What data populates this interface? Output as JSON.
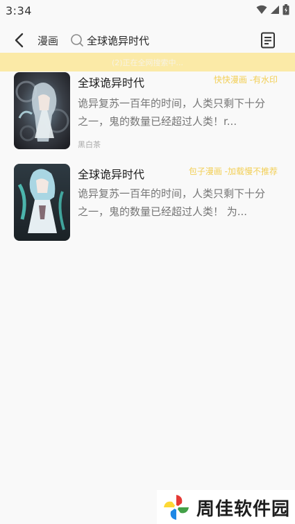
{
  "status_bar": {
    "time": "3:34"
  },
  "app_bar": {
    "back_icon": "back-arrow-icon",
    "category": "漫画",
    "search_icon": "search-icon",
    "search_query": "全球诡异时代",
    "bookshelf_icon": "book-list-icon"
  },
  "banner": {
    "text": "(2)正在全网搜索中..."
  },
  "results": [
    {
      "title": "全球诡异时代",
      "source": "快快漫画 -有水印",
      "description": "诡异复苏一百年的时间，人类只剩下十分之一，鬼的数量已经超过人类！r...",
      "author": "黑白茶"
    },
    {
      "title": "全球诡异时代",
      "source": "包子漫画 -加载慢不推荐",
      "description": "诡异复苏一百年的时间，人类只剩下十分之一，鬼的数量已经超过人类！ 为...",
      "author": ""
    }
  ],
  "watermark": {
    "text": "周佳软件园"
  },
  "colors": {
    "accent_yellow": "#f2cf56",
    "banner_bg": "#fbeaa7",
    "background": "#f9f9f9"
  }
}
